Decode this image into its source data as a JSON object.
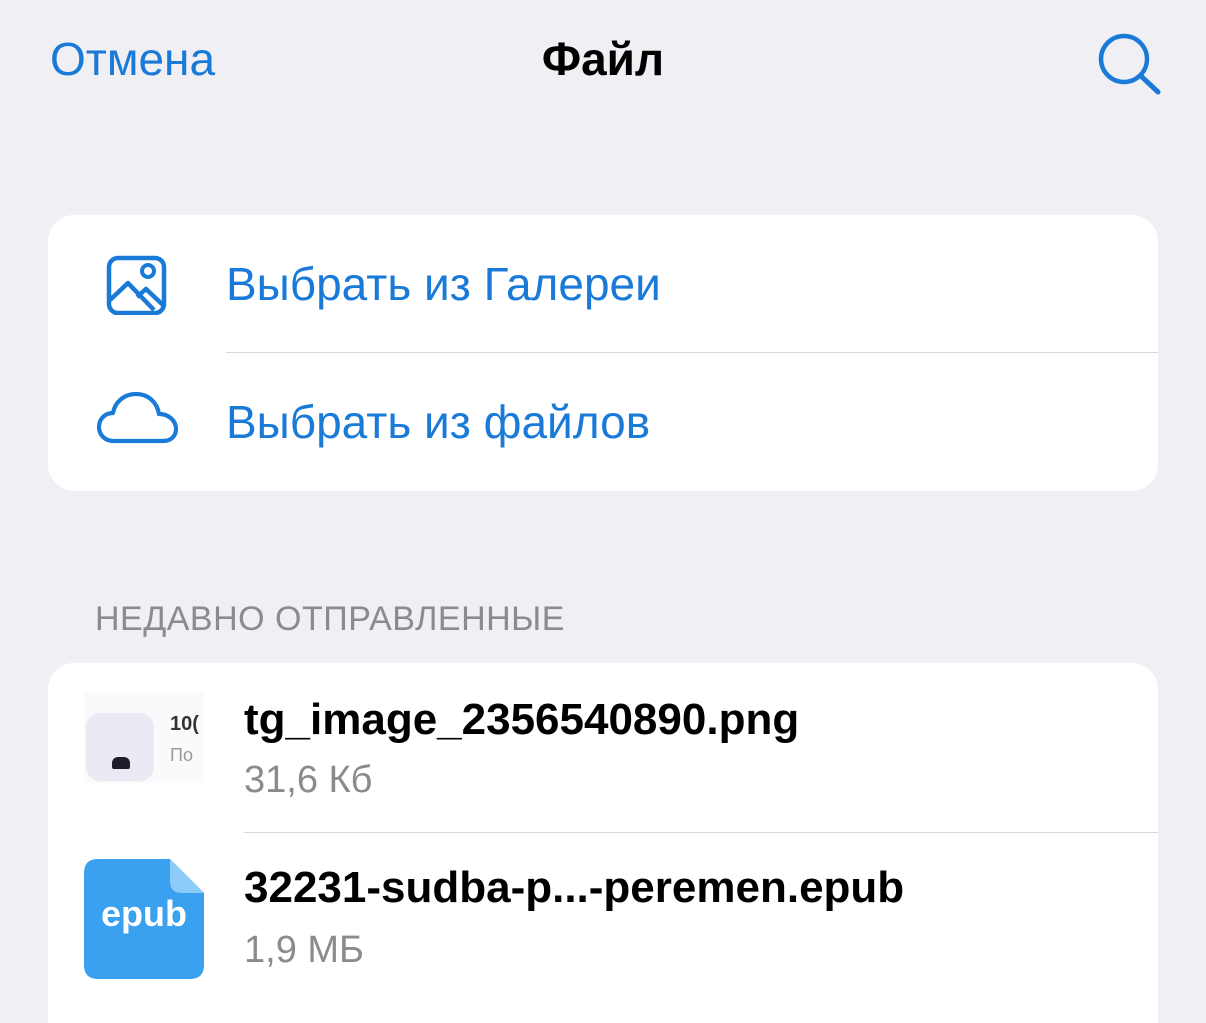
{
  "header": {
    "cancel_label": "Отмена",
    "title": "Файл",
    "search_icon": "search-icon"
  },
  "actions": {
    "items": [
      {
        "icon": "gallery-icon",
        "label": "Выбрать из Галереи"
      },
      {
        "icon": "cloud-icon",
        "label": "Выбрать из файлов"
      }
    ]
  },
  "recent": {
    "section_title": "НЕДАВНО ОТПРАВЛЕННЫЕ",
    "files": [
      {
        "name": "tg_image_2356540890.png",
        "size": "31,6 Кб",
        "thumb_text_1": "10(",
        "thumb_text_2": "По"
      },
      {
        "name": "32231-sudba-p...-peremen.epub",
        "size": "1,9 МБ",
        "icon_label": "epub"
      }
    ]
  },
  "colors": {
    "accent": "#1a7ad8",
    "background": "#efeff4",
    "secondary_text": "#8a8a8f",
    "epub_icon": "#3aa0f0"
  }
}
